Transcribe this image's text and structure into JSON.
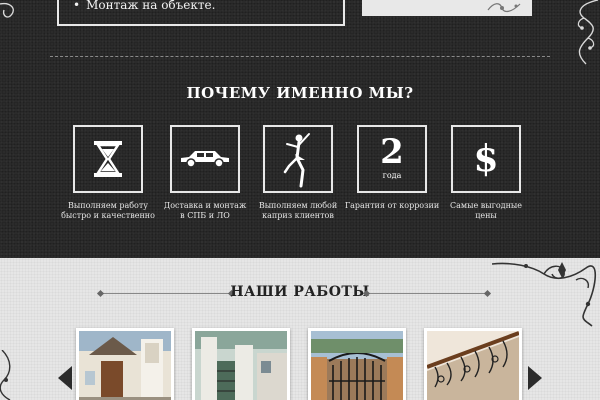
{
  "header": {
    "list_item": "Монтаж на объекте."
  },
  "why_us": {
    "title": "ПОЧЕМУ ИМЕННО МЫ?",
    "features": [
      {
        "icon": "hourglass-icon",
        "caption_line1": "Выполняем работу",
        "caption_line2": "быстро и качественно"
      },
      {
        "icon": "car-icon",
        "caption_line1": "Доставка и монтаж",
        "caption_line2": "в СПБ и ЛО"
      },
      {
        "icon": "dancer-icon",
        "caption_line1": "Выполняем любой",
        "caption_line2": "каприз клиентов"
      },
      {
        "icon": "warranty-icon",
        "number": "2",
        "number_sub": "года",
        "caption_line1": "Гарантия от коррозии",
        "caption_line2": ""
      },
      {
        "icon": "dollar-icon",
        "symbol": "$",
        "caption_line1": "Самые выгодные",
        "caption_line2": "цены"
      }
    ]
  },
  "works": {
    "title": "НАШИ РАБОТЫ",
    "thumbnails": [
      {
        "icon": "house-porch-photo"
      },
      {
        "icon": "house-columns-photo"
      },
      {
        "icon": "wrought-gate-photo"
      },
      {
        "icon": "stair-railing-photo"
      }
    ]
  },
  "colors": {
    "dark_bg": "#2b2b2b",
    "light_bg": "#e6e6e6",
    "text_light": "#ffffff",
    "text_dark": "#222222"
  }
}
